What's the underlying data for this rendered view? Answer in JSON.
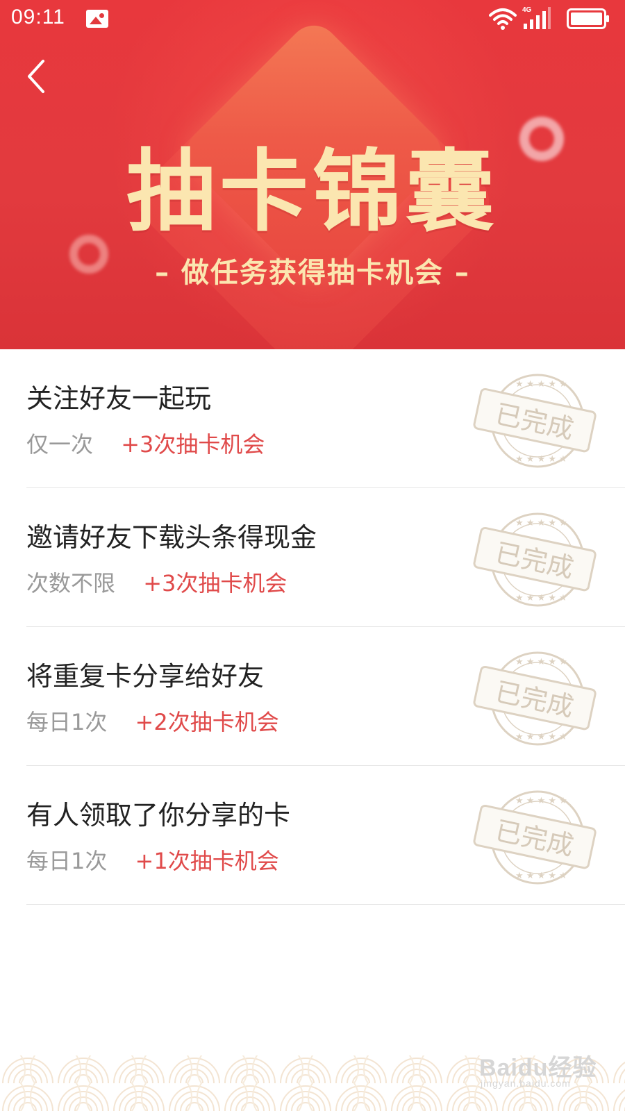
{
  "status_bar": {
    "time": "09:11",
    "network": "4G"
  },
  "header": {
    "title": "抽卡锦囊",
    "subtitle": "– 做任务获得抽卡机会 –"
  },
  "tasks": [
    {
      "title": "关注好友一起玩",
      "frequency": "仅一次",
      "reward": "+3次抽卡机会",
      "status": "已完成"
    },
    {
      "title": "邀请好友下载头条得现金",
      "frequency": "次数不限",
      "reward": "+3次抽卡机会",
      "status": "已完成"
    },
    {
      "title": "将重复卡分享给好友",
      "frequency": "每日1次",
      "reward": "+2次抽卡机会",
      "status": "已完成"
    },
    {
      "title": "有人领取了你分享的卡",
      "frequency": "每日1次",
      "reward": "+1次抽卡机会",
      "status": "已完成"
    }
  ],
  "watermark": {
    "main": "Baidu经验",
    "sub": "jingyan.baidu.com"
  },
  "colors": {
    "header_red": "#e23a3e",
    "title_cream": "#fbe6b0",
    "reward_red": "#e04a4a",
    "stamp_tan": "#cfc1ad"
  },
  "icons": {
    "back": "chevron-left-icon",
    "stamp": "completed-stamp-icon"
  }
}
